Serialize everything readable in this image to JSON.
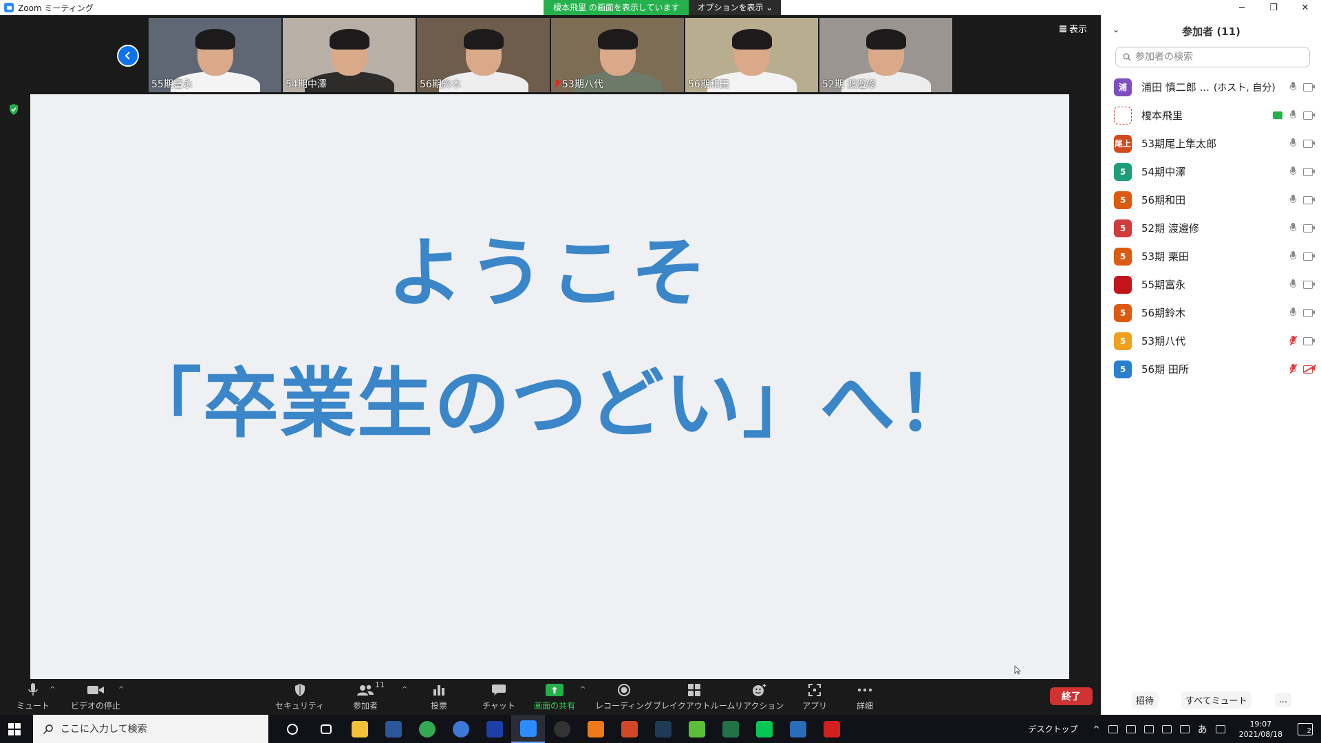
{
  "window": {
    "title": "Zoom ミーティング",
    "controls": [
      "─",
      "❐",
      "✕"
    ]
  },
  "share_banner": {
    "status": "榎本飛里 の画面を表示しています",
    "options": "オプションを表示 ⌄"
  },
  "gallery": {
    "view_label": "表示",
    "tiles": [
      {
        "name": "55期富永",
        "muted": false,
        "bg": "#5f6775",
        "shirt": "#f4f4f4"
      },
      {
        "name": "54期中澤",
        "muted": false,
        "bg": "#b8b0a6",
        "shirt": "#2e2b2b"
      },
      {
        "name": "56期鈴木",
        "muted": false,
        "bg": "#6e5d4c",
        "shirt": "#eeeeee"
      },
      {
        "name": "53期八代",
        "muted": true,
        "bg": "#7d6d54",
        "shirt": "#6d7a6a"
      },
      {
        "name": "56期和田",
        "muted": false,
        "bg": "#b9ad90",
        "shirt": "#f3f3f3"
      },
      {
        "name": "52期 渡邉修",
        "muted": false,
        "bg": "#9a9590",
        "shirt": "#ededed"
      }
    ]
  },
  "slide": {
    "line1": "ようこそ",
    "line2": "「卒業生のつどい」へ！",
    "text_color": "#3a86c8"
  },
  "toolbar": {
    "mute": "ミュート",
    "video": "ビデオの停止",
    "security": "セキュリティ",
    "participants": "参加者",
    "participants_count": "11",
    "polls": "投票",
    "chat": "チャット",
    "share": "画面の共有",
    "record": "レコーディング",
    "breakout": "ブレイクアウトルーム",
    "reactions": "リアクション",
    "apps": "アプリ",
    "more": "詳細",
    "end": "終了"
  },
  "panel": {
    "title": "参加者 (11)",
    "search_placeholder": "参加者の検索",
    "participants": [
      {
        "name": "浦田 慎二郎 ...",
        "tag": "(ホスト, 自分)",
        "avatar": "浦",
        "color": "#7e4fc0",
        "mic_muted": false,
        "cam_off": false,
        "sharing": false
      },
      {
        "name": "榎本飛里",
        "tag": "",
        "avatar": "",
        "color": "#ffffff",
        "mic_muted": false,
        "cam_off": false,
        "sharing": true
      },
      {
        "name": "53期尾上隼太郎",
        "tag": "",
        "avatar": "尾上",
        "color": "#d04a1c",
        "mic_muted": false,
        "cam_off": false,
        "sharing": false
      },
      {
        "name": "54期中澤",
        "tag": "",
        "avatar": "5",
        "color": "#1f9d7a",
        "mic_muted": false,
        "cam_off": false,
        "sharing": false
      },
      {
        "name": "56期和田",
        "tag": "",
        "avatar": "5",
        "color": "#dd5a12",
        "mic_muted": false,
        "cam_off": false,
        "sharing": false
      },
      {
        "name": "52期 渡邉修",
        "tag": "",
        "avatar": "5",
        "color": "#d03b3b",
        "mic_muted": false,
        "cam_off": false,
        "sharing": false
      },
      {
        "name": "53期 栗田",
        "tag": "",
        "avatar": "5",
        "color": "#dd5a12",
        "mic_muted": false,
        "cam_off": false,
        "sharing": false
      },
      {
        "name": "55期富永",
        "tag": "",
        "avatar": "",
        "color": "#c3161c",
        "mic_muted": false,
        "cam_off": false,
        "sharing": false
      },
      {
        "name": "56期鈴木",
        "tag": "",
        "avatar": "5",
        "color": "#dd5a12",
        "mic_muted": false,
        "cam_off": false,
        "sharing": false
      },
      {
        "name": "53期八代",
        "tag": "",
        "avatar": "5",
        "color": "#f0a020",
        "mic_muted": true,
        "cam_off": false,
        "sharing": false
      },
      {
        "name": "56期 田所",
        "tag": "",
        "avatar": "5",
        "color": "#2a7fd0",
        "mic_muted": true,
        "cam_off": true,
        "sharing": false
      }
    ],
    "footer": {
      "invite": "招待",
      "mute_all": "すべてミュート",
      "more": "..."
    }
  },
  "taskbar": {
    "search_placeholder": "ここに入力して検索",
    "apps": [
      {
        "name": "cortana",
        "color": "#000000",
        "active": false
      },
      {
        "name": "task-view",
        "color": "#000000",
        "active": false
      },
      {
        "name": "explorer",
        "color": "#f3c13a",
        "active": false
      },
      {
        "name": "word",
        "color": "#2b579a",
        "active": false
      },
      {
        "name": "chrome",
        "color": "#34a853",
        "active": false
      },
      {
        "name": "app-blue",
        "color": "#3b78d8",
        "active": false
      },
      {
        "name": "tan",
        "color": "#1f3fa8",
        "active": false
      },
      {
        "name": "zoom",
        "color": "#2d8cff",
        "active": true
      },
      {
        "name": "media",
        "color": "#333333",
        "active": false
      },
      {
        "name": "search-app",
        "color": "#f07a1a",
        "active": false
      },
      {
        "name": "powerpoint",
        "color": "#d24726",
        "active": false
      },
      {
        "name": "app-dark",
        "color": "#1d3a56",
        "active": false
      },
      {
        "name": "clover",
        "color": "#5bbf3b",
        "active": false
      },
      {
        "name": "excel",
        "color": "#217346",
        "active": false
      },
      {
        "name": "line",
        "color": "#06c755",
        "active": false
      },
      {
        "name": "photos",
        "color": "#2a6db8",
        "active": false
      },
      {
        "name": "acrobat",
        "color": "#d41f1f",
        "active": false
      }
    ],
    "desktop_label": "デスクトップ",
    "ime": "あ",
    "time": "19:07",
    "date": "2021/08/18",
    "notifications": "2"
  }
}
